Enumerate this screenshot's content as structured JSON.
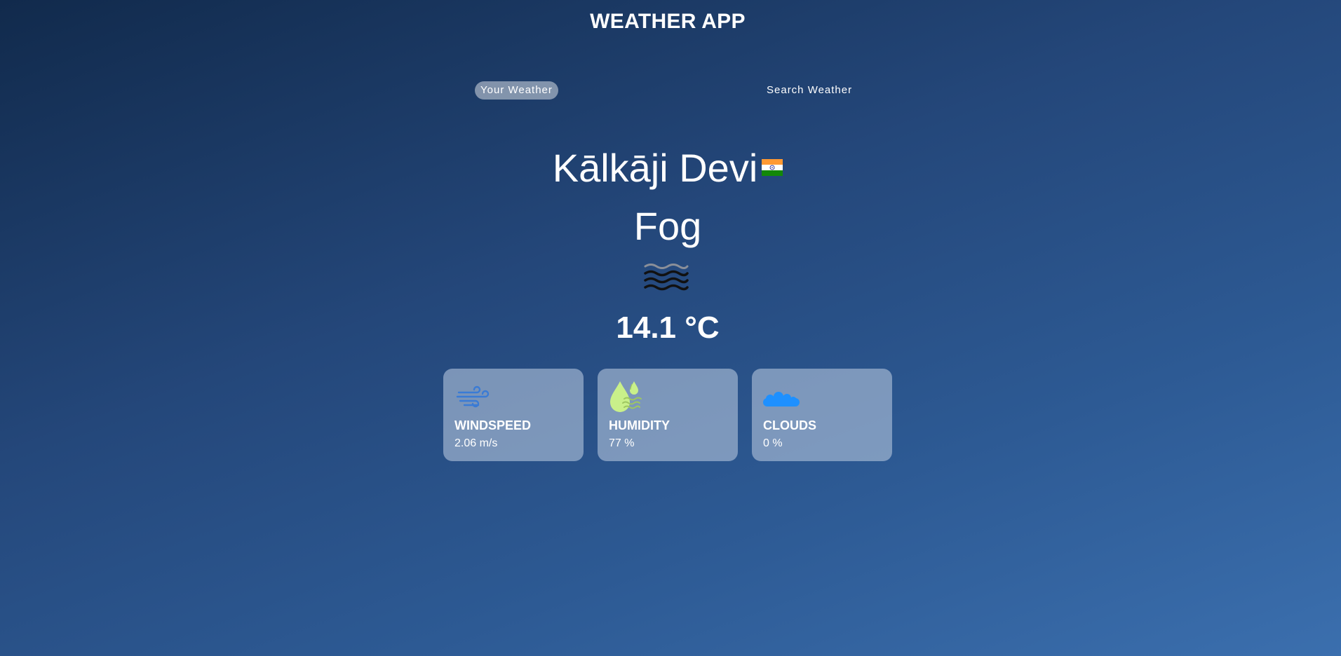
{
  "app": {
    "title": "WEATHER APP"
  },
  "tabs": [
    {
      "label": "Your Weather",
      "active": true
    },
    {
      "label": "Search Weather",
      "active": false
    }
  ],
  "location": {
    "name": "Kālkāji Devi",
    "flag_icon": "india-flag-icon"
  },
  "weather": {
    "condition": "Fog",
    "condition_icon": "fog-icon",
    "temperature": "14.1 °C"
  },
  "cards": [
    {
      "label": "WINDSPEED",
      "value": "2.06 m/s",
      "icon": "wind-icon",
      "color": "#3a7bd5"
    },
    {
      "label": "HUMIDITY",
      "value": "77 %",
      "icon": "humidity-icon",
      "color": "#c9f08a"
    },
    {
      "label": "CLOUDS",
      "value": "0 %",
      "icon": "clouds-icon",
      "color": "#1e90ff"
    }
  ]
}
